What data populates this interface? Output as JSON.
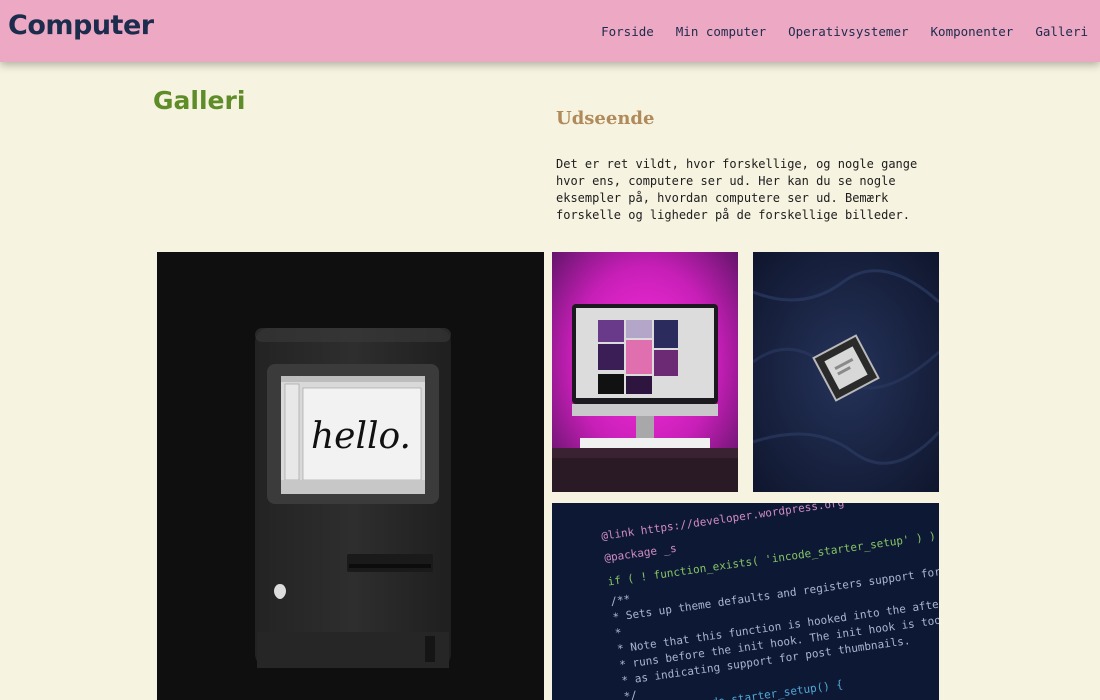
{
  "site": {
    "logo": "Computer"
  },
  "nav": {
    "items": [
      {
        "label": "Forside"
      },
      {
        "label": "Min computer"
      },
      {
        "label": "Operativsystemer"
      },
      {
        "label": "Komponenter"
      },
      {
        "label": "Galleri"
      }
    ]
  },
  "main": {
    "title": "Galleri",
    "subtitle": "Udseende",
    "intro": "Det er ret vildt, hvor forskellige, og nogle gange hvor ens, computere ser ud. Her kan du se nogle eksempler på, hvordan computere ser ud. Bemærk forskelle og ligheder på de forskellige billeder."
  },
  "gallery": {
    "mac_screen_text": "hello.",
    "code_lines": [
      "@link https://developer.wordpress.org",
      "@package _s",
      "if ( ! function_exists( 'incode_starter_setup' ) ) :",
      "/**",
      " * Sets up theme defaults and registers support for various WordPress features.",
      " *",
      " * Note that this function is hooked into the after_setup_theme hook, which",
      " * runs before the init hook. The init hook is too late for some features, such",
      " * as indicating support for post thumbnails.",
      " */",
      "function incode_starter_setup() {"
    ]
  },
  "colors": {
    "header_bg": "#eda8c3",
    "page_bg": "#f6f3e0",
    "title_green": "#5e8c28",
    "subtitle_brown": "#b08a5a",
    "nav_text": "#1c2c4d"
  }
}
